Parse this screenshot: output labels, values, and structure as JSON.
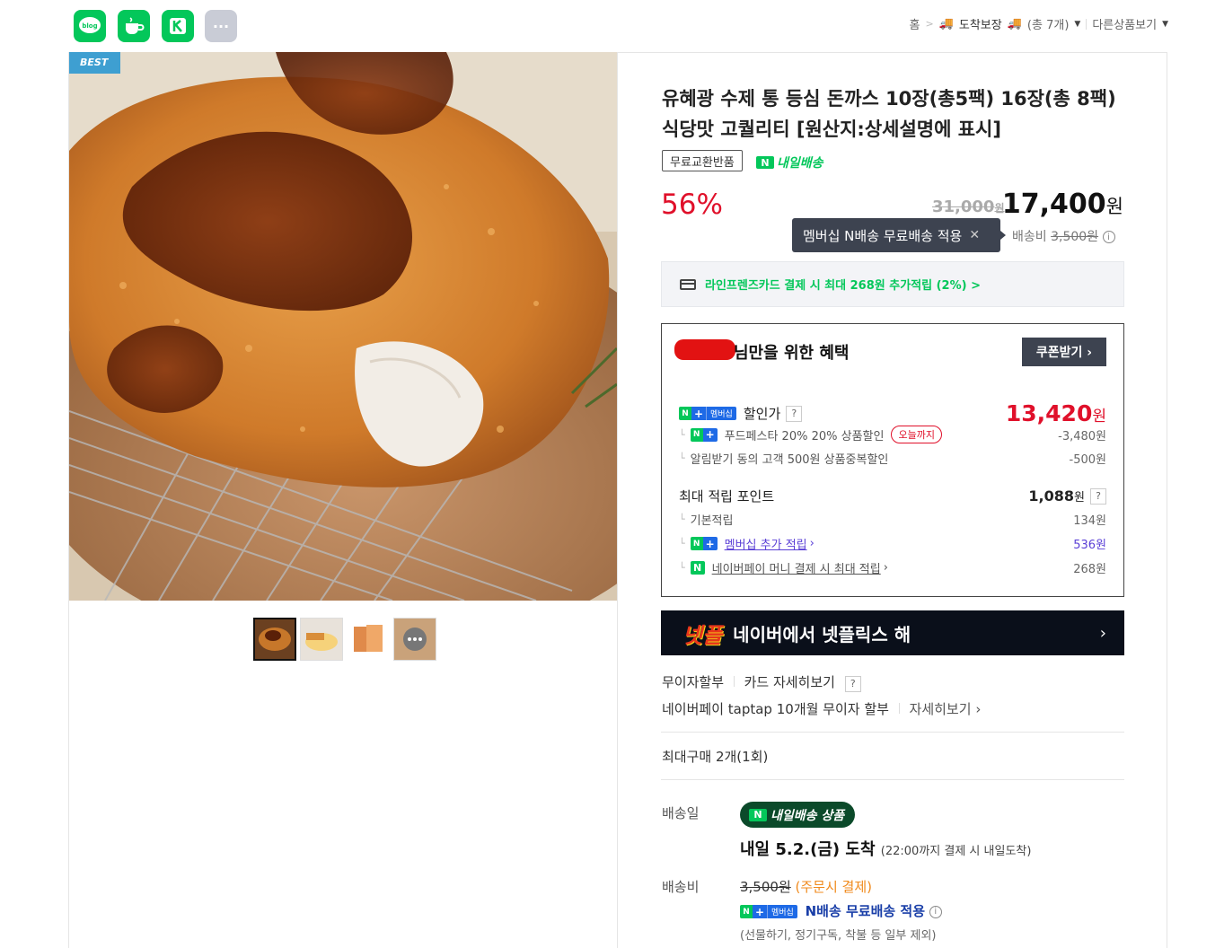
{
  "share_icons": [
    {
      "name": "blog-icon",
      "label": "blog",
      "color": "#03c75a"
    },
    {
      "name": "cafe-icon",
      "label": "",
      "color": "#03c75a"
    },
    {
      "name": "band-icon",
      "label": "",
      "color": "#03c75a"
    },
    {
      "name": "more-icon",
      "label": "···",
      "color": "#c9ccd6"
    }
  ],
  "breadcrumb": {
    "home": "홈",
    "category": "도착보장",
    "count": "(총 7개)",
    "other": "다른상품보기"
  },
  "product": {
    "badge": "BEST",
    "title_line1": "유혜광 수제 통 등심 돈까스 10장(총5팩) 16장(총 8팩)",
    "title_line2": "식당맛 고퀄리티 [원산지:상세설명에 표시]",
    "return_tag": "무료교환반품",
    "tomorrow_label": "내일배송",
    "discount": "56%",
    "original_price": "31,000",
    "original_unit": "원",
    "sale_price": "17,400",
    "sale_unit": "원",
    "tooltip": "멤버십 N배송 무료배송 적용",
    "shipping_label": "배송비",
    "shipping_fee": "3,500원"
  },
  "card_promo": "라인프렌즈카드 결제 시 최대 268원 추가적립 (2%) >",
  "benefit": {
    "heading": "님만을 위한 혜택",
    "coupon_button": "쿠폰받기 ›",
    "membership_badge": "멤버십",
    "discount_price_label": "할인가",
    "discount_price": "13,420",
    "discount_price_unit": "원",
    "sub1_label": "푸드페스타 20% 20% 상품할인",
    "sub1_tag": "오늘까지",
    "sub1_value": "-3,480원",
    "sub2_label": "알림받기 동의 고객 500원 상품중복할인",
    "sub2_value": "-500원",
    "points_label": "최대 적립 포인트",
    "points_value": "1,088",
    "points_unit": "원",
    "basic_label": "기본적립",
    "basic_value": "134원",
    "member_label": "멤버십 추가 적립",
    "member_value": "536원",
    "pay_label": "네이버페이 머니 결제 시 최대 적립",
    "pay_value": "268원"
  },
  "banner": {
    "logo": "넷플",
    "text": "네이버에서 넷플릭스 해"
  },
  "installment": {
    "label": "무이자할부",
    "card_link": "카드 자세히보기",
    "taptap": "네이버페이 taptap 10개월 무이자 할부",
    "detail": "자세히보기"
  },
  "max_purchase": "최대구매 2개(1회)",
  "delivery": {
    "date_label": "배송일",
    "pill": "내일배송 상품",
    "arrival": "내일 5.2.(금) 도착",
    "arrival_note": "(22:00까지 결제 시 내일도착)",
    "fee_label": "배송비",
    "fee": "3,500원",
    "fee_note": "(주문시 결제)",
    "free_text": "N배송 무료배송 적용",
    "exclusion": "(선물하기, 정기구독, 착불 등 일부 제외)"
  },
  "colors": {
    "naver_green": "#03c75a",
    "sale_red": "#e0102a",
    "tooltip_bg": "#3d4350",
    "membership_blue": "#1e6ae6"
  }
}
